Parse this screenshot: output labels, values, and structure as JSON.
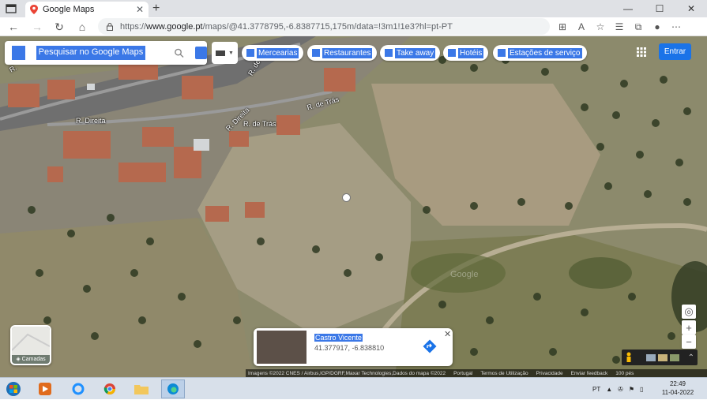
{
  "browser": {
    "tab_title": "Google Maps",
    "url_prefix": "https://",
    "url_domain": "www.google.pt",
    "url_path": "/maps/@41.3778795,-6.8387715,175m/data=!3m1!1e3?hl=pt-PT"
  },
  "maps": {
    "search_placeholder": "Pesquisar no Google Maps",
    "chips": [
      "Mercearias",
      "Restaurantes",
      "Take away",
      "Hotéis",
      "Estações de serviço"
    ],
    "signin_label": "Entrar",
    "road_labels": [
      "R. Direita",
      "R. de Trás",
      "R. de Trás",
      "R. de Trás",
      "R."
    ],
    "layers_label": "Camadas",
    "watermark": "Google",
    "place_card": {
      "title": "Castro Vicente",
      "coords": "41.377917, -6.838810"
    },
    "footer": {
      "attribution": "Imagens ©2022 CNES / Airbus,IGP/DGRF,Maxar Technologies,Dados do mapa ©2022",
      "links": [
        "Portugal",
        "Termos de Utilização",
        "Privacidade",
        "Enviar feedback"
      ],
      "scale": "100 pés"
    }
  },
  "taskbar": {
    "lang": "PT",
    "time": "22:49",
    "date": "11-04-2022"
  },
  "colors": {
    "accent": "#3b78e7",
    "signin": "#1a73e8"
  }
}
